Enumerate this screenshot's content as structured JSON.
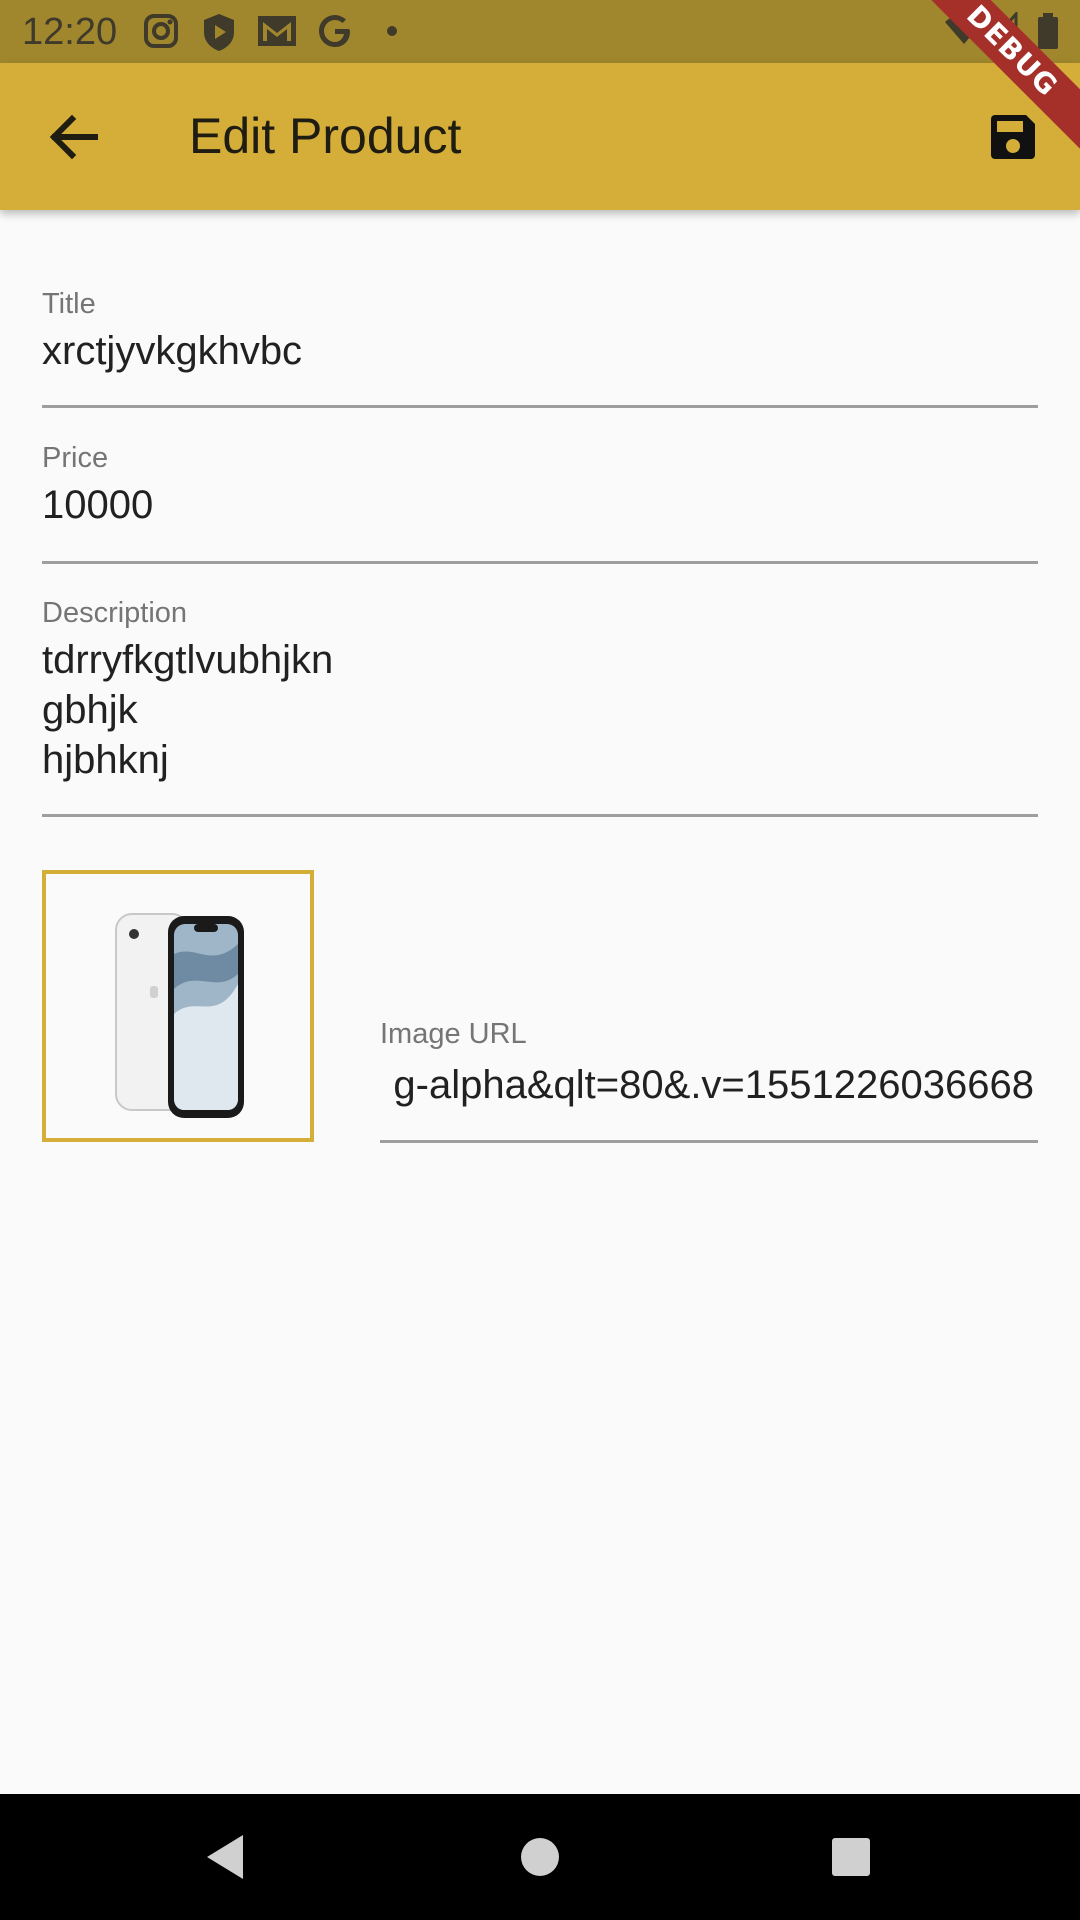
{
  "status_bar": {
    "time": "12:20",
    "icons": [
      "instagram-icon",
      "shield-play-icon",
      "gmail-icon",
      "google-icon",
      "dot-icon",
      "wifi-icon",
      "signal-icon",
      "battery-icon"
    ]
  },
  "app_bar": {
    "title": "Edit Product",
    "back_icon": "arrow-back-icon",
    "save_icon": "save-icon"
  },
  "debug_banner": "DEBUG",
  "form": {
    "title": {
      "label": "Title",
      "value": "xrctjyvkgkhvbc"
    },
    "price": {
      "label": "Price",
      "value": "10000"
    },
    "description": {
      "label": "Description",
      "value": "tdrryfkgtlvubhjkn\ngbhjk\nhjbhknj"
    },
    "image_url": {
      "label": "Image URL",
      "value": "g-alpha&qlt=80&.v=1551226036668"
    }
  },
  "nav_bar": {
    "back_icon": "nav-back-icon",
    "home_icon": "nav-home-icon",
    "recents_icon": "nav-recents-icon"
  },
  "colors": {
    "app_bar": "#d4ae38",
    "status_bar": "#a0872e",
    "image_border": "#d4ae38",
    "debug_ribbon": "#a5302a"
  }
}
